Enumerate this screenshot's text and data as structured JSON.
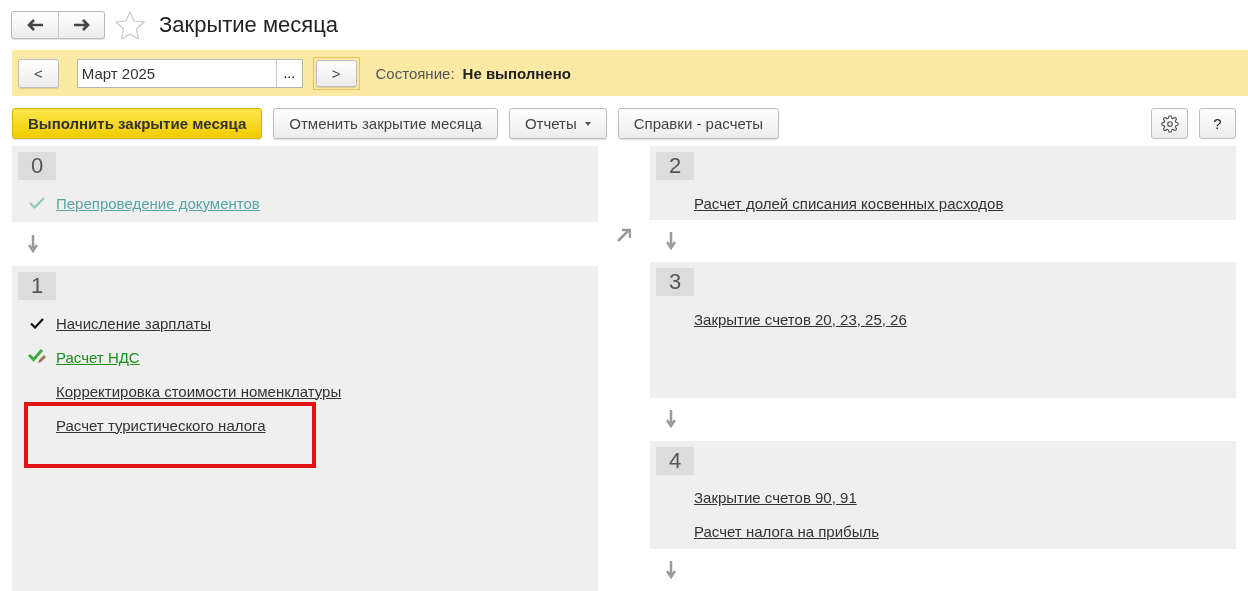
{
  "window": {
    "title": "Закрытие месяца",
    "favorite": false
  },
  "period": {
    "prev": "<",
    "value": "Март 2025",
    "choose": "...",
    "next": ">",
    "status_label": "Состояние:",
    "status_value": "Не выполнено"
  },
  "toolbar": {
    "buttons": [
      {
        "label": "Выполнить закрытие месяца",
        "kind": "primary"
      },
      {
        "label": "Отменить закрытие месяца",
        "kind": "plain"
      },
      {
        "label": "Отчеты",
        "kind": "menu"
      },
      {
        "label": "Справки - расчеты",
        "kind": "plain"
      }
    ],
    "help": "?"
  },
  "columns": [
    {
      "stages": [
        {
          "number": "0",
          "arrow_after": true,
          "items": [
            {
              "label": "Перепроведение документов",
              "kind": "faded",
              "checked": true,
              "highlighted": false
            }
          ]
        },
        {
          "number": "1",
          "arrow_after": false,
          "items": [
            {
              "label": "Начисление зарплаты",
              "kind": "plain",
              "checked": true,
              "highlighted": false
            },
            {
              "label": "Расчет НДС",
              "kind": "edited",
              "checked": true,
              "highlighted": false
            },
            {
              "label": "Корректировка стоимости номенклатуры",
              "kind": "plain",
              "checked": false,
              "highlighted": false
            },
            {
              "label": "Расчет туристического налога",
              "kind": "plain",
              "checked": false,
              "highlighted": true
            }
          ]
        }
      ]
    },
    {
      "stages": [
        {
          "number": "2",
          "arrow_after": true,
          "items": [
            {
              "label": "Расчет долей списания косвенных расходов",
              "kind": "plain",
              "checked": false,
              "highlighted": false
            }
          ]
        },
        {
          "number": "3",
          "arrow_after": true,
          "items": [
            {
              "label": "Закрытие счетов 20, 23, 25, 26",
              "kind": "plain",
              "checked": false,
              "highlighted": false
            }
          ]
        },
        {
          "number": "4",
          "arrow_after": true,
          "items": [
            {
              "label": "Закрытие счетов 90, 91",
              "kind": "plain",
              "checked": false,
              "highlighted": false
            },
            {
              "label": "Расчет налога на прибыль",
              "kind": "plain",
              "checked": false,
              "highlighted": false
            }
          ]
        }
      ]
    }
  ]
}
